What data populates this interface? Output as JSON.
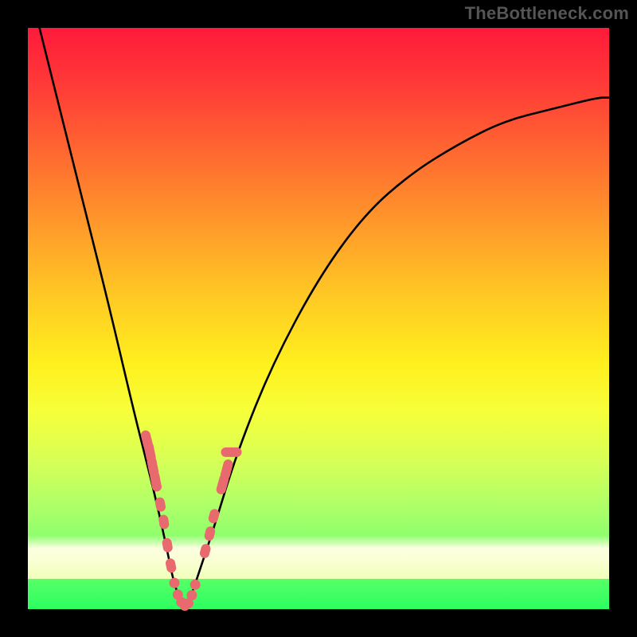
{
  "watermark": "TheBottleneck.com",
  "colors": {
    "marker": "#e86a6e",
    "curve": "#000000"
  },
  "chart_data": {
    "type": "line",
    "title": "",
    "xlabel": "",
    "ylabel": "",
    "xlim": [
      0,
      100
    ],
    "ylim": [
      0,
      100
    ],
    "grid": false,
    "legend": false,
    "series": [
      {
        "name": "compatibility-curve",
        "x": [
          2,
          6,
          10,
          14,
          18,
          20,
          22,
          24,
          25,
          26,
          27,
          28,
          30,
          32,
          36,
          42,
          50,
          58,
          66,
          74,
          82,
          90,
          98,
          100
        ],
        "values": [
          100,
          84,
          68,
          52,
          35,
          27,
          19,
          10,
          5,
          2,
          0,
          2,
          8,
          14,
          27,
          42,
          57,
          68,
          75,
          80,
          84,
          86,
          88,
          88
        ]
      }
    ],
    "markers": {
      "comment": "salmon dots/pills along the V, near the valley",
      "points_xy": [
        [
          20.5,
          29
        ],
        [
          21,
          27
        ],
        [
          21.5,
          24.5
        ],
        [
          22,
          22
        ],
        [
          22.8,
          18
        ],
        [
          23.4,
          15
        ],
        [
          24.0,
          11
        ],
        [
          24.6,
          7.5
        ],
        [
          25.2,
          4.5
        ],
        [
          25.8,
          2.5
        ],
        [
          26.4,
          1.2
        ],
        [
          27.0,
          0.6
        ],
        [
          27.6,
          1.0
        ],
        [
          28.2,
          2.4
        ],
        [
          28.8,
          4.2
        ],
        [
          30.5,
          10
        ],
        [
          31.3,
          13
        ],
        [
          32.0,
          16
        ],
        [
          33.5,
          21.5
        ],
        [
          34.2,
          24
        ],
        [
          35.0,
          27
        ]
      ]
    },
    "background_gradient_stops": [
      {
        "pos": 0.0,
        "color": "#ff1a3a"
      },
      {
        "pos": 0.22,
        "color": "#ff6a30"
      },
      {
        "pos": 0.46,
        "color": "#ffc824"
      },
      {
        "pos": 0.66,
        "color": "#f6ff3a"
      },
      {
        "pos": 0.9,
        "color": "#7fff6e"
      },
      {
        "pos": 1.0,
        "color": "#2cff60"
      }
    ]
  }
}
